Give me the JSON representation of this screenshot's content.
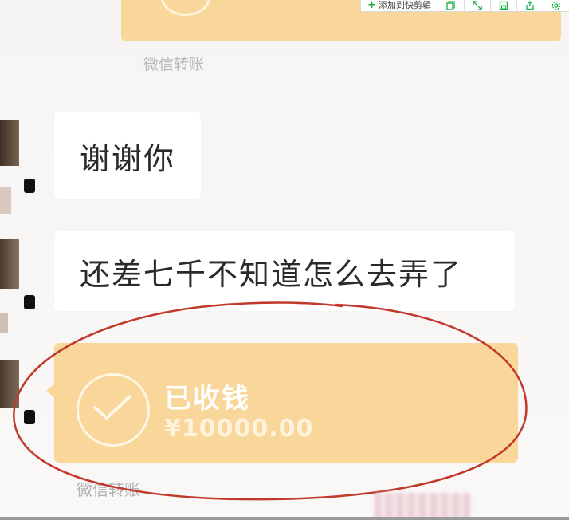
{
  "toolbar": {
    "add_label": "添加到快剪辑",
    "buttons": [
      "copy-icon",
      "expand-icon",
      "save-icon",
      "share-icon",
      "settings-icon"
    ]
  },
  "chat": {
    "top_transfer_label": "微信转账",
    "messages": [
      {
        "text": "谢谢你"
      },
      {
        "text": "还差七千不知道怎么去弄了"
      }
    ],
    "transfer": {
      "status": "已收钱",
      "amount": "¥10000.00",
      "label": "微信转账"
    }
  },
  "colors": {
    "transfer_card": "#f9d79a",
    "annotation": "#c0392b",
    "bubble": "#ffffff",
    "background": "#f7f6f4"
  }
}
